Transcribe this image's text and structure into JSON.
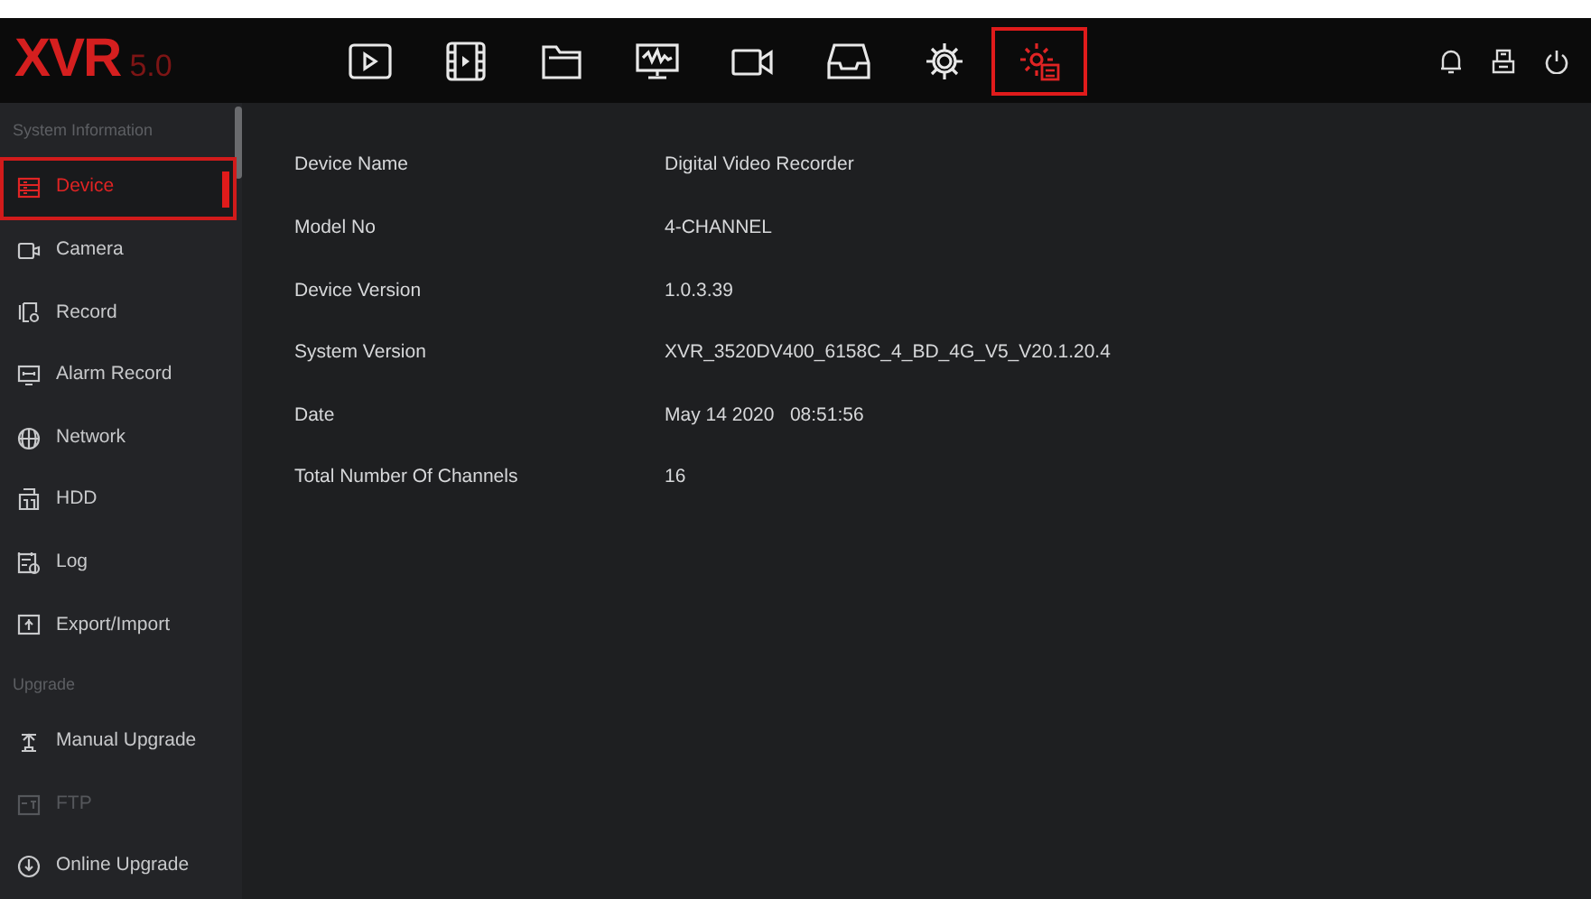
{
  "logo": {
    "brand": "XVR",
    "version": "5.0"
  },
  "toolbar": [
    {
      "selected": false
    },
    {
      "selected": false
    },
    {
      "selected": false
    },
    {
      "selected": false
    },
    {
      "selected": false
    },
    {
      "selected": false
    },
    {
      "selected": false
    },
    {
      "selected": true
    }
  ],
  "sidebar": {
    "items": [
      {
        "kind": "header",
        "label": "System Information"
      },
      {
        "kind": "item",
        "label": "Device",
        "selected": true,
        "disabled": false
      },
      {
        "kind": "item",
        "label": "Camera",
        "selected": false,
        "disabled": false
      },
      {
        "kind": "item",
        "label": "Record",
        "selected": false,
        "disabled": false
      },
      {
        "kind": "item",
        "label": "Alarm Record",
        "selected": false,
        "disabled": false
      },
      {
        "kind": "item",
        "label": "Network",
        "selected": false,
        "disabled": false
      },
      {
        "kind": "item",
        "label": "HDD",
        "selected": false,
        "disabled": false
      },
      {
        "kind": "item",
        "label": "Log",
        "selected": false,
        "disabled": false
      },
      {
        "kind": "item",
        "label": "Export/Import",
        "selected": false,
        "disabled": false
      },
      {
        "kind": "header",
        "label": "Upgrade"
      },
      {
        "kind": "item",
        "label": "Manual Upgrade",
        "selected": false,
        "disabled": false
      },
      {
        "kind": "item",
        "label": "FTP",
        "selected": false,
        "disabled": true
      },
      {
        "kind": "item",
        "label": "Online Upgrade",
        "selected": false,
        "disabled": false
      }
    ]
  },
  "info": [
    {
      "label": "Device Name",
      "value": "Digital Video Recorder"
    },
    {
      "label": "Model No",
      "value": "4-CHANNEL"
    },
    {
      "label": "Device Version",
      "value": "1.0.3.39"
    },
    {
      "label": "System Version",
      "value": "XVR_3520DV400_6158C_4_BD_4G_V5_V20.1.20.4"
    },
    {
      "label": "Date",
      "value": "May 14 2020   08:51:56"
    },
    {
      "label": "Total Number Of Channels",
      "value": "16"
    }
  ]
}
